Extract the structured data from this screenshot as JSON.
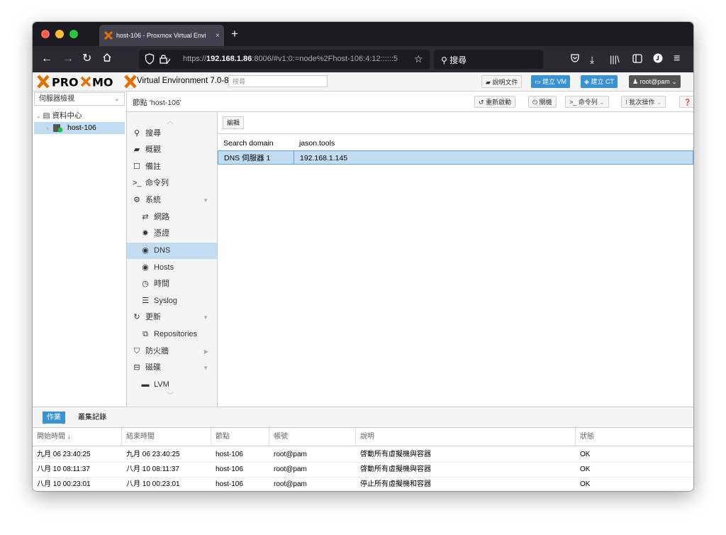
{
  "browser": {
    "tab_title": "host-106 - Proxmox Virtual Envi",
    "tab_close": "×",
    "new_tab": "+",
    "url_prefix": "https://",
    "url_host": "192.168.1.86",
    "url_rest": ":8006/#v1:0:=node%2Fhost-106:4:12::::::5",
    "search_placeholder": "搜尋"
  },
  "header": {
    "version": "Virtual Environment 7.0-8",
    "search_placeholder": "搜尋",
    "docs": "說明文件",
    "create_vm": "建立 VM",
    "create_ct": "建立 CT",
    "user": "root@pam"
  },
  "tree": {
    "view": "伺服器檢視",
    "datacenter": "資料中心",
    "node": "host-106"
  },
  "node_header": {
    "title": "節點 'host-106'",
    "reboot": "重新啟動",
    "shutdown": "關機",
    "shell": "命令列",
    "bulk": "批次操作",
    "help": "說明"
  },
  "menu": {
    "search": "搜尋",
    "summary": "概觀",
    "notes": "備註",
    "shell": "命令列",
    "system": "系統",
    "network": "網路",
    "certificates": "憑證",
    "dns": "DNS",
    "hosts": "Hosts",
    "time": "時間",
    "syslog": "Syslog",
    "updates": "更新",
    "repositories": "Repositories",
    "firewall": "防火牆",
    "disks": "磁碟",
    "lvm": "LVM"
  },
  "dns": {
    "edit": "編輯",
    "rows": [
      {
        "key": "Search domain",
        "value": "jason.tools"
      },
      {
        "key": "DNS 伺服器 1",
        "value": "192.168.1.145"
      }
    ]
  },
  "bottom": {
    "tab_tasks": "作業",
    "tab_cluster_log": "叢集記錄",
    "columns": [
      "開始時間 ↓",
      "結束時間",
      "節點",
      "帳號",
      "說明",
      "狀態"
    ],
    "rows": [
      [
        "九月 06 23:40:25",
        "九月 06 23:40:25",
        "host-106",
        "root@pam",
        "啓動所有虛擬機與容器",
        "OK"
      ],
      [
        "八月 10 08:11:37",
        "八月 10 08:11:37",
        "host-106",
        "root@pam",
        "啓動所有虛擬機與容器",
        "OK"
      ],
      [
        "八月 10 00:23:01",
        "八月 10 00:23:01",
        "host-106",
        "root@pam",
        "停止所有虛擬機和容器",
        "OK"
      ]
    ]
  },
  "colors": {
    "accent": "#3892d4",
    "selection": "#c2ddf2",
    "proxmox_orange": "#e57000"
  }
}
